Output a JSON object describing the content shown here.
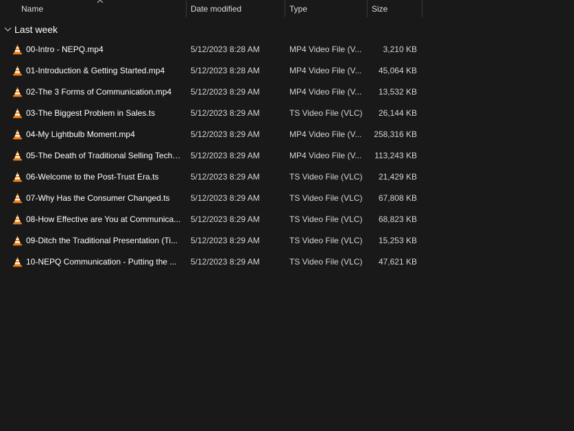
{
  "columns": {
    "name": "Name",
    "date": "Date modified",
    "type": "Type",
    "size": "Size"
  },
  "group": {
    "label": "Last week"
  },
  "icon": "vlc-cone-icon",
  "colors": {
    "background": "#191919",
    "cone_orange": "#f58a1f",
    "cone_stripe": "#ffffff"
  },
  "files": [
    {
      "name": "00-Intro - NEPQ.mp4",
      "date": "5/12/2023 8:28 AM",
      "type": "MP4 Video File (V...",
      "size": "3,210 KB"
    },
    {
      "name": "01-Introduction & Getting Started.mp4",
      "date": "5/12/2023 8:28 AM",
      "type": "MP4 Video File (V...",
      "size": "45,064 KB"
    },
    {
      "name": "02-The 3 Forms of Communication.mp4",
      "date": "5/12/2023 8:29 AM",
      "type": "MP4 Video File (V...",
      "size": "13,532 KB"
    },
    {
      "name": "03-The Biggest Problem in Sales.ts",
      "date": "5/12/2023 8:29 AM",
      "type": "TS Video File (VLC)",
      "size": "26,144 KB"
    },
    {
      "name": "04-My Lightbulb Moment.mp4",
      "date": "5/12/2023 8:29 AM",
      "type": "MP4 Video File (V...",
      "size": "258,316 KB"
    },
    {
      "name": "05-The Death of Traditional Selling Techni...",
      "date": "5/12/2023 8:29 AM",
      "type": "MP4 Video File (V...",
      "size": "113,243 KB"
    },
    {
      "name": "06-Welcome to the Post-Trust Era.ts",
      "date": "5/12/2023 8:29 AM",
      "type": "TS Video File (VLC)",
      "size": "21,429 KB"
    },
    {
      "name": "07-Why Has the Consumer Changed.ts",
      "date": "5/12/2023 8:29 AM",
      "type": "TS Video File (VLC)",
      "size": "67,808 KB"
    },
    {
      "name": "08-How Effective are You at Communica...",
      "date": "5/12/2023 8:29 AM",
      "type": "TS Video File (VLC)",
      "size": "68,823 KB"
    },
    {
      "name": "09-Ditch the Traditional Presentation (Ti...",
      "date": "5/12/2023 8:29 AM",
      "type": "TS Video File (VLC)",
      "size": "15,253 KB"
    },
    {
      "name": "10-NEPQ Communication - Putting the ...",
      "date": "5/12/2023 8:29 AM",
      "type": "TS Video File (VLC)",
      "size": "47,621 KB"
    }
  ]
}
